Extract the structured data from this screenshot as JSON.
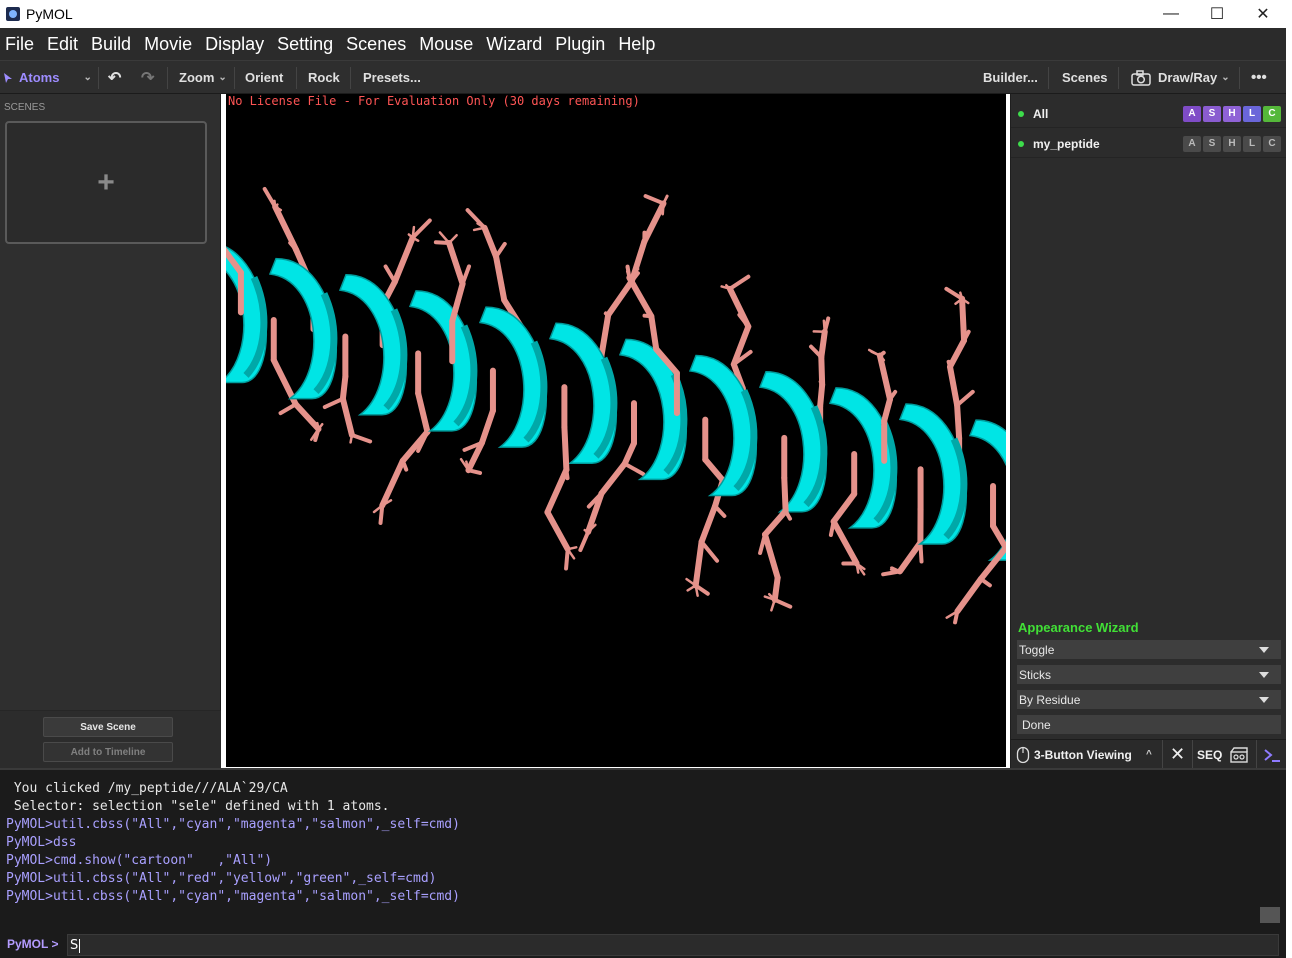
{
  "window": {
    "title": "PyMOL",
    "minimize": "—",
    "maximize": "☐",
    "close": "✕"
  },
  "menu": [
    "File",
    "Edit",
    "Build",
    "Movie",
    "Display",
    "Setting",
    "Scenes",
    "Mouse",
    "Wizard",
    "Plugin",
    "Help"
  ],
  "toolbar": {
    "mode": "Atoms",
    "zoom": "Zoom",
    "orient": "Orient",
    "rock": "Rock",
    "presets": "Presets...",
    "builder": "Builder...",
    "scenes": "Scenes",
    "draw_ray": "Draw/Ray",
    "more": "•••"
  },
  "scenes_panel": {
    "label": "SCENES",
    "add": "+",
    "save_scene": "Save Scene",
    "add_to_timeline": "Add to Timeline"
  },
  "viewport": {
    "license": "No License File - For Evaluation Only (30 days remaining)",
    "cartoon_color": "#00e5e5",
    "stick_color": "#e5928b"
  },
  "objects": [
    {
      "name": "All",
      "buttons": [
        "A",
        "S",
        "H",
        "L",
        "C"
      ]
    },
    {
      "name": "my_peptide",
      "buttons": [
        "A",
        "S",
        "H",
        "L",
        "C"
      ]
    }
  ],
  "wizard": {
    "title": "Appearance Wizard",
    "options": [
      "Toggle",
      "Sticks",
      "By Residue"
    ],
    "done": "Done"
  },
  "bottom_bar": {
    "viewing_mode": "3-Button Viewing",
    "seq": "SEQ"
  },
  "console": {
    "lines": [
      {
        "type": "out",
        "text": " You clicked /my_peptide///ALA`29/CA"
      },
      {
        "type": "out",
        "text": " Selector: selection \"sele\" defined with 1 atoms."
      },
      {
        "type": "cmd",
        "text": "PyMOL>util.cbss(\"All\",\"cyan\",\"magenta\",\"salmon\",_self=cmd)"
      },
      {
        "type": "cmd",
        "text": "PyMOL>dss"
      },
      {
        "type": "cmd",
        "text": "PyMOL>cmd.show(\"cartoon\"   ,\"All\")"
      },
      {
        "type": "cmd",
        "text": "PyMOL>util.cbss(\"All\",\"red\",\"yellow\",\"green\",_self=cmd)"
      },
      {
        "type": "cmd",
        "text": "PyMOL>util.cbss(\"All\",\"cyan\",\"magenta\",\"salmon\",_self=cmd)"
      }
    ],
    "prompt": "PyMOL >",
    "input_value": "S"
  }
}
